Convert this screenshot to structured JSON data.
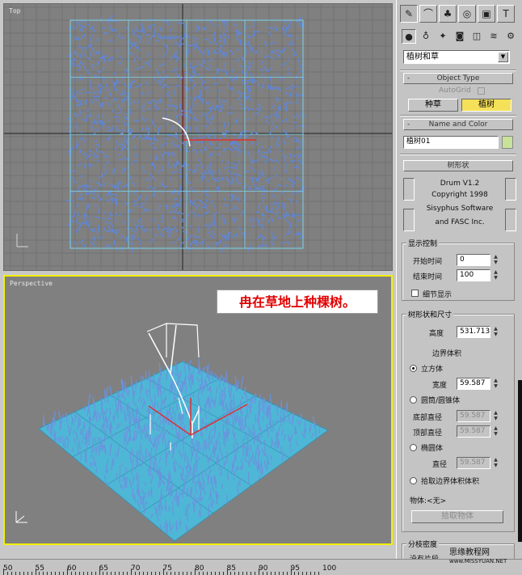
{
  "viewports": {
    "top": {
      "label": "Top"
    },
    "perspective": {
      "label": "Perspective",
      "caption": "冉在草地上种棵树。"
    }
  },
  "command_panel": {
    "main_tabs": [
      {
        "name": "create-tab-icon",
        "glyph": "✎",
        "active": true
      },
      {
        "name": "modify-tab-icon",
        "glyph": "⌒",
        "active": false
      },
      {
        "name": "hierarchy-tab-icon",
        "glyph": "♣",
        "active": false
      },
      {
        "name": "motion-tab-icon",
        "glyph": "◎",
        "active": false
      },
      {
        "name": "display-tab-icon",
        "glyph": "▣",
        "active": false
      },
      {
        "name": "utilities-tab-icon",
        "glyph": "T",
        "active": false
      }
    ],
    "sub_tabs": [
      {
        "name": "geometry-icon",
        "glyph": "●",
        "active": true
      },
      {
        "name": "shapes-icon",
        "glyph": "♁",
        "active": false
      },
      {
        "name": "lights-icon",
        "glyph": "✦",
        "active": false
      },
      {
        "name": "cameras-icon",
        "glyph": "◙",
        "active": false
      },
      {
        "name": "helpers-icon",
        "glyph": "◫",
        "active": false
      },
      {
        "name": "spacewarps-icon",
        "glyph": "≋",
        "active": false
      },
      {
        "name": "systems-icon",
        "glyph": "⚙",
        "active": false
      }
    ],
    "category_dropdown": "植树和草",
    "object_type": {
      "title": "Object Type",
      "autogrid": "AutoGrid",
      "buttons": [
        "种草",
        "植树"
      ]
    },
    "name_color": {
      "title": "Name and Color",
      "name_value": "植树01",
      "color": "#c8e29a"
    },
    "tree_shape_header": "树形状",
    "credits": [
      "Drum V1.2",
      "Copyright 1998",
      "Sisyphus Software",
      "and FASC Inc."
    ],
    "display_control": {
      "title": "显示控制",
      "start_time_label": "开始时间",
      "start_time_value": "0",
      "end_time_label": "结束时间",
      "end_time_value": "100",
      "detail_label": "细节显示"
    },
    "tree_size": {
      "title": "树形状和尺寸",
      "height_label": "高度",
      "height_value": "531.713",
      "bounding_label": "边界体积",
      "cube_label": "立方体",
      "width_label": "宽度",
      "width_value": "59.587",
      "cone_label": "圆筒/圆锥体",
      "bottom_radius_label": "底部直径",
      "bottom_radius_value": "59.587",
      "top_radius_label": "顶部直径",
      "top_radius_value": "59.587",
      "sphere_label": "椭圆体",
      "diameter_label": "直径",
      "diameter_value": "59.587",
      "pick_label": "拾取边界体积体积",
      "object_label": "物体:<无>",
      "pick_button": "拾取物体"
    },
    "branch_density": {
      "title": "分枝密度",
      "no_leaf_label": "没有片段"
    }
  },
  "timeline": {
    "labels": [
      "50",
      "55",
      "60",
      "65",
      "70",
      "75",
      "80",
      "85",
      "90",
      "95",
      "100"
    ]
  },
  "watermark": {
    "line1": "思缘教程网",
    "line2": "www.MISSYUAN.NET"
  }
}
